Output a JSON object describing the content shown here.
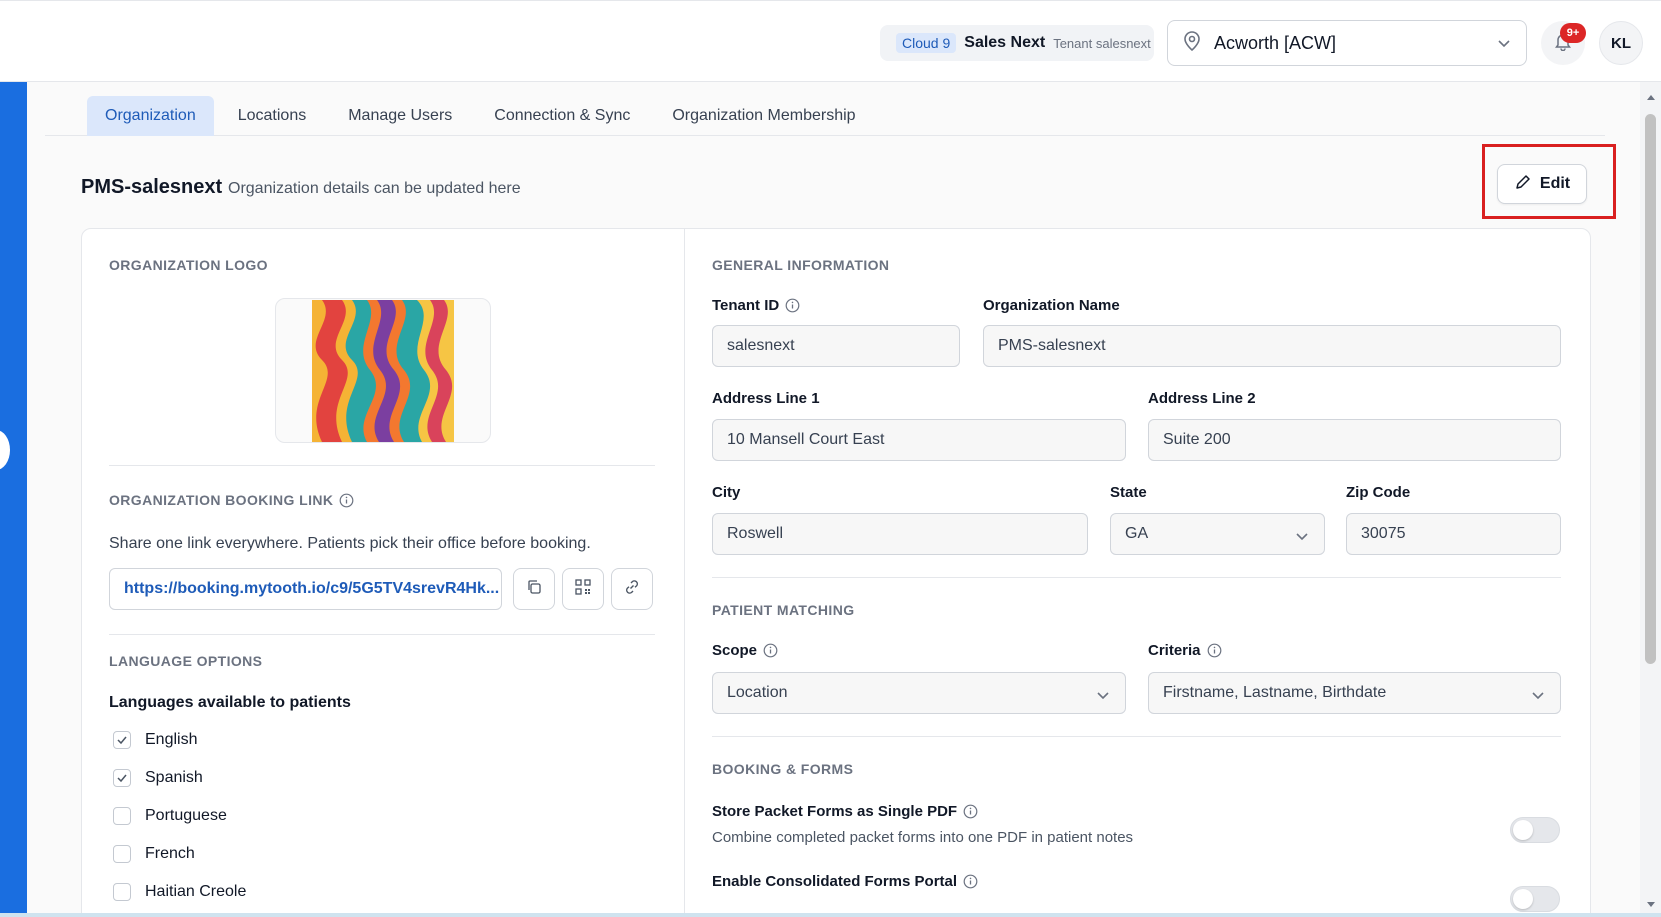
{
  "header": {
    "tenant_badge": "Cloud 9",
    "tenant_name": "Sales Next",
    "tenant_sub": "Tenant salesnext",
    "location": "Acworth [ACW]",
    "notification_count": "9+",
    "avatar_initials": "KL"
  },
  "tabs": [
    {
      "label": "Organization",
      "active": true
    },
    {
      "label": "Locations"
    },
    {
      "label": "Manage Users"
    },
    {
      "label": "Connection & Sync"
    },
    {
      "label": "Organization Membership"
    }
  ],
  "page": {
    "title": "PMS-salesnext",
    "subtitle": "Organization details can be updated here",
    "edit_label": "Edit"
  },
  "left": {
    "logo_title": "ORGANIZATION LOGO",
    "booking_title": "ORGANIZATION BOOKING LINK",
    "booking_desc": "Share one link everywhere. Patients pick their office before booking.",
    "booking_url": "https://booking.mytooth.io/c9/5G5TV4srevR4Hk...",
    "language_title": "LANGUAGE OPTIONS",
    "languages_label": "Languages available to patients",
    "languages": [
      {
        "name": "English",
        "checked": true
      },
      {
        "name": "Spanish",
        "checked": true
      },
      {
        "name": "Portuguese",
        "checked": false
      },
      {
        "name": "French",
        "checked": false
      },
      {
        "name": "Haitian Creole",
        "checked": false
      }
    ]
  },
  "general": {
    "title": "GENERAL INFORMATION",
    "tenant_id_label": "Tenant ID",
    "tenant_id": "salesnext",
    "org_name_label": "Organization Name",
    "org_name": "PMS-salesnext",
    "address1_label": "Address Line 1",
    "address1": "10 Mansell Court East",
    "address2_label": "Address Line 2",
    "address2": "Suite 200",
    "city_label": "City",
    "city": "Roswell",
    "state_label": "State",
    "state": "GA",
    "zip_label": "Zip Code",
    "zip": "30075"
  },
  "matching": {
    "title": "PATIENT MATCHING",
    "scope_label": "Scope",
    "scope": "Location",
    "criteria_label": "Criteria",
    "criteria": "Firstname, Lastname, Birthdate"
  },
  "booking": {
    "title": "BOOKING & FORMS",
    "store_title": "Store Packet Forms as Single PDF",
    "store_desc": "Combine completed packet forms into one PDF in patient notes",
    "store_enabled": false,
    "portal_title": "Enable Consolidated Forms Portal",
    "portal_enabled": false
  },
  "colors": {
    "accent": "#1a6ee0",
    "active_tab_bg": "#dbe7fb",
    "highlight": "#d92020",
    "badge": "#dc2626"
  }
}
